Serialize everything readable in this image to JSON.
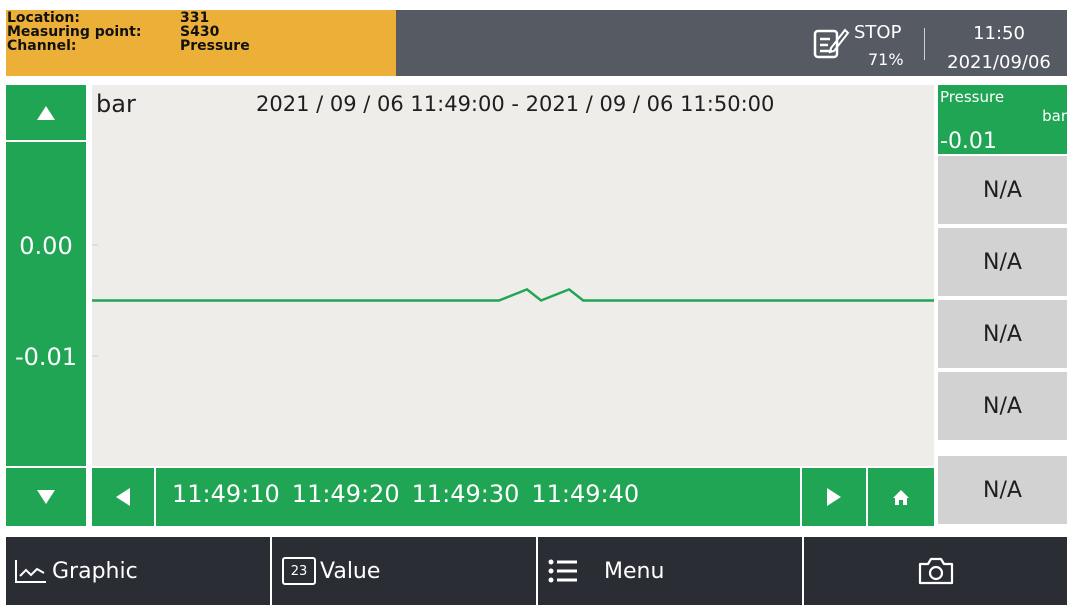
{
  "header": {
    "location_label": "Location:",
    "location_value": "331",
    "measuring_point_label": "Measuring point:",
    "measuring_point_value": "S430",
    "channel_label": "Channel:",
    "channel_value": "Pressure",
    "record_state": "STOP",
    "memory_used": "71%",
    "time": "11:50",
    "date": "2021/09/06",
    "record_icon": "edit-record-icon"
  },
  "chart_data": {
    "type": "line",
    "unit": "bar",
    "title": "2021 / 09 / 06 11:49:00 - 2021 / 09 / 06 11:50:00",
    "y_ticks": [
      "0.00",
      "-0.01"
    ],
    "x_ticks": [
      "11:49:10",
      "11:49:20",
      "11:49:30",
      "11:49:40"
    ],
    "xlim": [
      "11:49:00",
      "11:50:00"
    ],
    "grid": false,
    "series": [
      {
        "color": "#1fa553",
        "x": [
          "11:49:00",
          "11:49:29",
          "11:49:31",
          "11:49:32",
          "11:49:34",
          "11:49:35",
          "11:50:00"
        ],
        "y": [
          -0.005,
          -0.005,
          -0.004,
          -0.005,
          -0.004,
          -0.005,
          -0.005
        ]
      }
    ]
  },
  "channels": {
    "active": {
      "name": "Pressure",
      "unit": "bar",
      "value": "-0.01"
    },
    "slots": [
      "N/A",
      "N/A",
      "N/A",
      "N/A",
      "N/A"
    ]
  },
  "footer": {
    "graphic_label": "Graphic",
    "value_label": "Value",
    "value_icon_text": "23",
    "menu_label": "Menu"
  },
  "colors": {
    "accent": "#1fa553",
    "header_bg": "#565a62",
    "info_bg": "#ecb038",
    "footer_bg": "#2a2d34",
    "chart_bg": "#efedea",
    "slot_bg": "#d2d2d2"
  }
}
